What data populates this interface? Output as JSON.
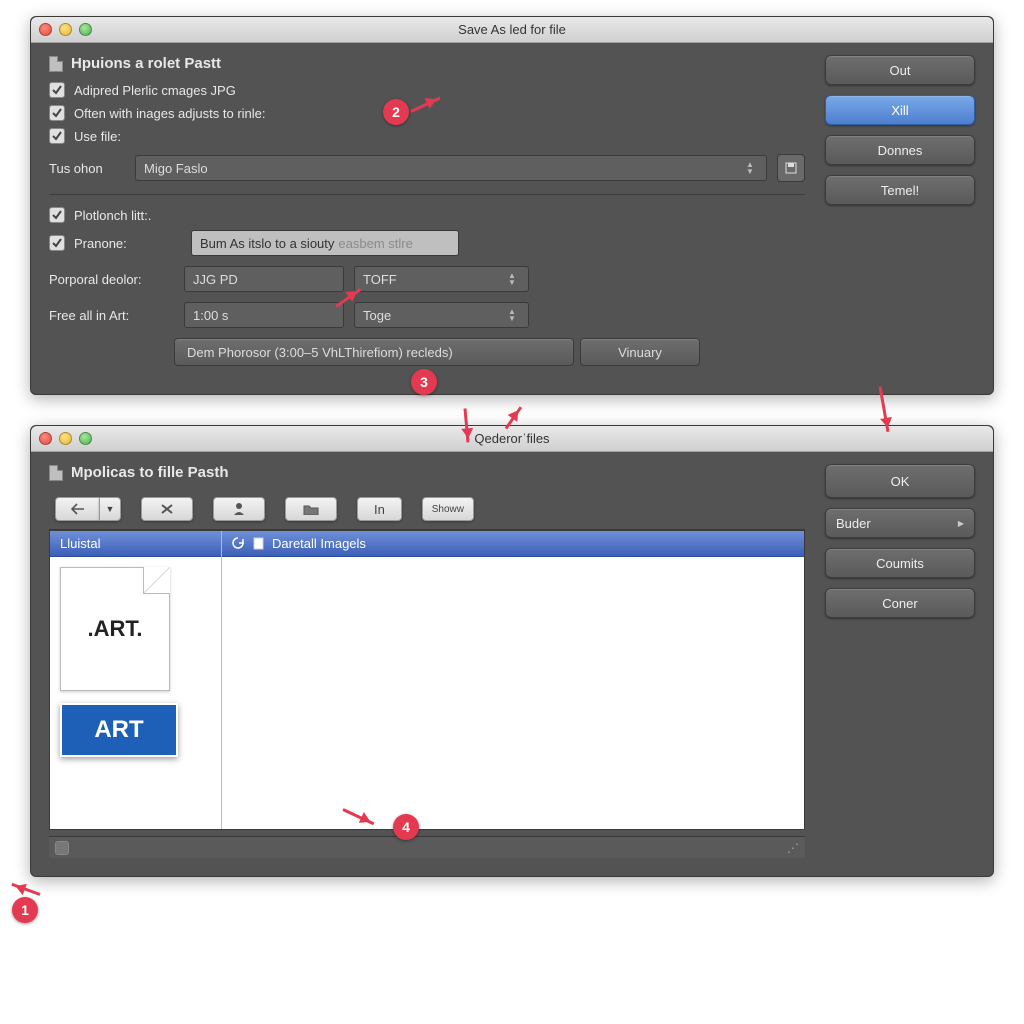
{
  "window1": {
    "title": "Save As led for file",
    "section_title": "Hpuions a rolet Pastt",
    "chk1": "Adipred Plerlic cmages JPG",
    "chk2": "Often with inages adjusts to rinle:",
    "chk3": "Use file:",
    "dd_label": "Tus ohon",
    "dd_value": "Migo Faslo",
    "chk4": "Plotlonch litt:.",
    "chk5": "Pranone:",
    "field5_text": "Bum As itslo to a siouty",
    "field5_placeholder": "easbem stlre",
    "row_a_label": "Porporal deolor:",
    "row_a_val": "JJG PD",
    "row_a_unit": "TOFF",
    "row_b_label": "Free all in Art:",
    "row_b_val": "1:00 s",
    "row_b_unit": "Toge",
    "long_btn": "Dem Phorosor (3:00–5 VhLThirefiom) recleds)",
    "aux_btn": "Vinuary",
    "side": {
      "b1": "Out",
      "b2": "Xill",
      "b3": "Donnes",
      "b4": "Temel!"
    }
  },
  "window2": {
    "title": "Qederorˈfiles",
    "section_title": "Mpolicas to fille Pasth",
    "toolbar": {
      "in": "In",
      "small": "Showw"
    },
    "col_left": "Lluistal",
    "col_right": "Daretall Imagels",
    "file_ext": ".ART.",
    "file_badge": "ART",
    "side": {
      "b1": "OK",
      "b2": "Buder",
      "b3": "Coumits",
      "b4": "Coner"
    }
  },
  "anno": {
    "n1": "1",
    "n2": "2",
    "n3": "3",
    "n4": "4"
  }
}
